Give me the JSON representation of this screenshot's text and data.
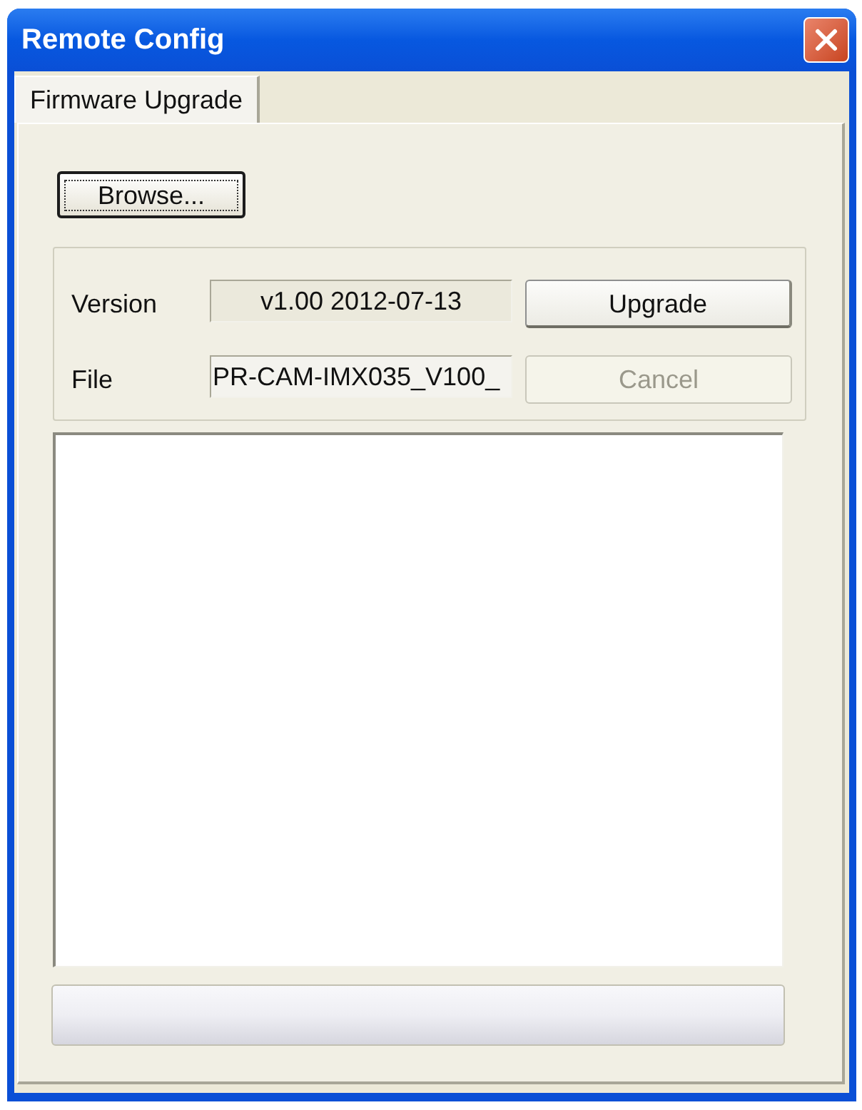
{
  "window": {
    "title": "Remote Config"
  },
  "tabs": [
    {
      "label": "Firmware Upgrade",
      "selected": true
    }
  ],
  "browse_button": {
    "label": "Browse...",
    "focused": true
  },
  "rows": [
    {
      "label": "Version",
      "kind": "display",
      "value": "v1.00 2012-07-13",
      "button": {
        "label": "Upgrade",
        "disabled": false
      }
    },
    {
      "label": "File",
      "kind": "path",
      "value": "PR-CAM-IMX035_V100_",
      "button": {
        "label": "Cancel",
        "disabled": true
      }
    }
  ],
  "progress": {
    "level": 0
  }
}
